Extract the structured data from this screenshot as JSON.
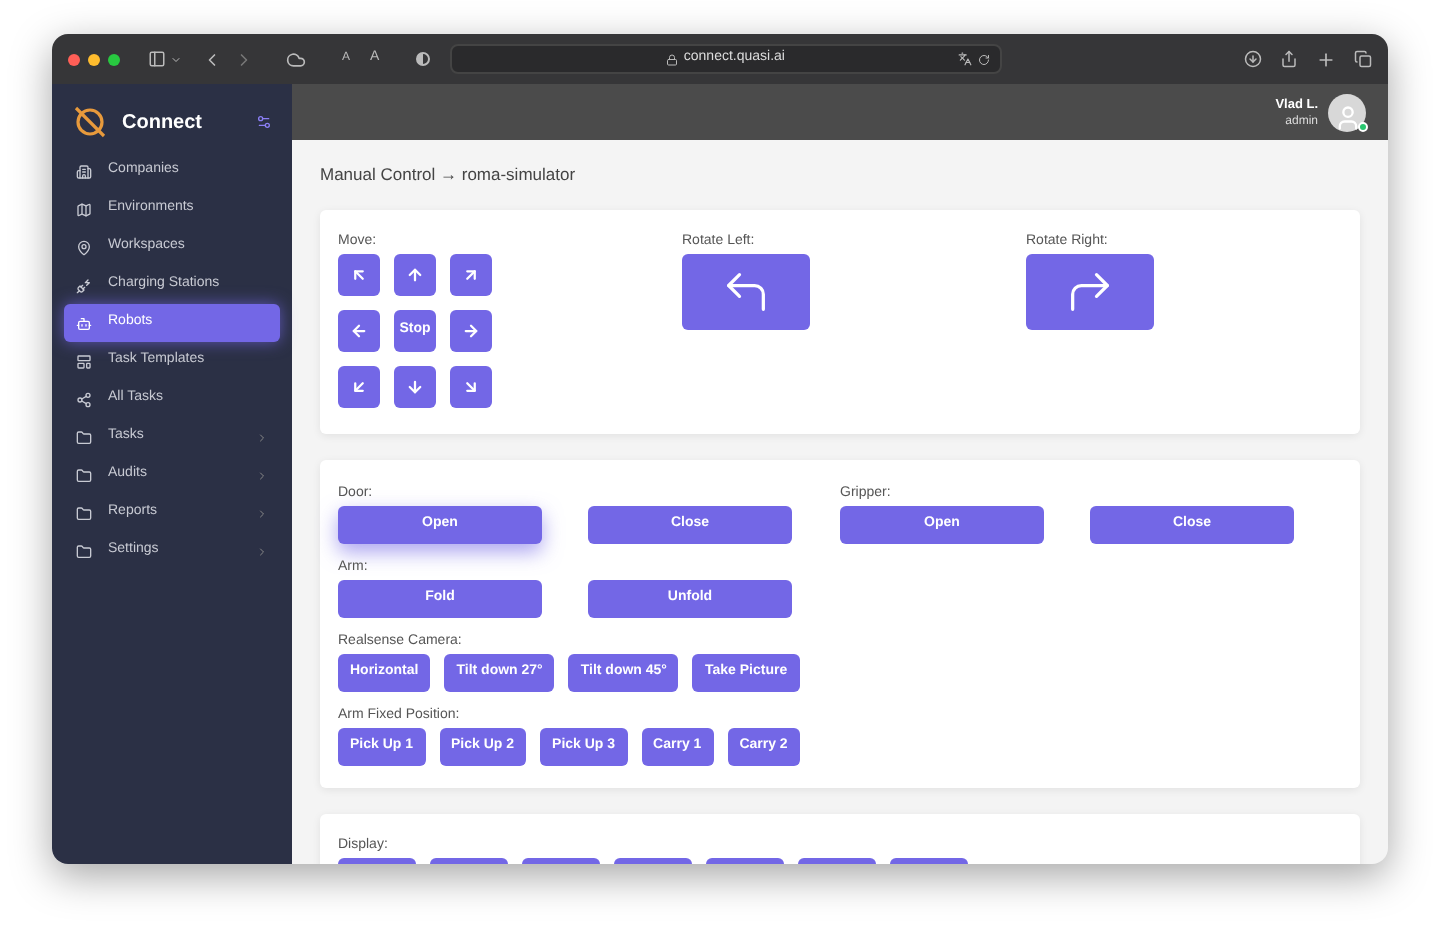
{
  "browser": {
    "text_size_small": "A",
    "text_size_large": "A",
    "url": "connect.quasi.ai"
  },
  "sidebar": {
    "brand": "Connect",
    "items": [
      {
        "label": "Companies",
        "kind": "link",
        "selected": false
      },
      {
        "label": "Environments",
        "kind": "link",
        "selected": false
      },
      {
        "label": "Workspaces",
        "kind": "link",
        "selected": false
      },
      {
        "label": "Charging Stations",
        "kind": "link",
        "selected": false
      },
      {
        "label": "Robots",
        "kind": "link",
        "selected": true
      },
      {
        "label": "Task Templates",
        "kind": "link",
        "selected": false
      },
      {
        "label": "All Tasks",
        "kind": "link",
        "selected": false
      },
      {
        "label": "Tasks",
        "kind": "group",
        "selected": false
      },
      {
        "label": "Audits",
        "kind": "group",
        "selected": false
      },
      {
        "label": "Reports",
        "kind": "group",
        "selected": false
      },
      {
        "label": "Settings",
        "kind": "group",
        "selected": false
      }
    ]
  },
  "header": {
    "user_name": "Vlad L.",
    "user_role": "admin",
    "online": true
  },
  "page_title": "Manual Control → roma-simulator",
  "motion": {
    "move_label": "Move:",
    "move_buttons": [
      {
        "kind": "arrow"
      },
      {
        "kind": "arrow"
      },
      {
        "kind": "arrow"
      },
      {
        "kind": "arrow"
      },
      {
        "kind": "text",
        "label": "Stop"
      },
      {
        "kind": "arrow"
      },
      {
        "kind": "arrow"
      },
      {
        "kind": "arrow"
      },
      {
        "kind": "arrow"
      }
    ],
    "rotate_left_label": "Rotate Left:",
    "rotate_right_label": "Rotate Right:"
  },
  "controls": {
    "door": {
      "label": "Door:",
      "buttons": [
        {
          "label": "Open",
          "focused": true
        },
        {
          "label": "Close",
          "focused": false
        }
      ]
    },
    "gripper": {
      "label": "Gripper:",
      "buttons": [
        {
          "label": "Open",
          "focused": false
        },
        {
          "label": "Close",
          "focused": false
        }
      ]
    },
    "arm": {
      "label": "Arm:",
      "buttons": [
        {
          "label": "Fold",
          "focused": false
        },
        {
          "label": "Unfold",
          "focused": false
        }
      ]
    },
    "camera": {
      "label": "Realsense Camera:",
      "buttons": [
        "Horizontal",
        "Tilt down 27°",
        "Tilt down 45°",
        "Take Picture"
      ]
    },
    "arm_fixed": {
      "label": "Arm Fixed Position:",
      "buttons": [
        "Pick Up 1",
        "Pick Up 2",
        "Pick Up 3",
        "Carry 1",
        "Carry 2"
      ]
    }
  },
  "display": {
    "label": "Display:"
  }
}
